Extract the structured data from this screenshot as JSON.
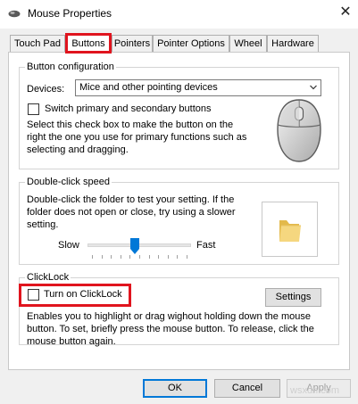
{
  "window": {
    "title": "Mouse Properties",
    "close_glyph": "✕"
  },
  "tabs": [
    {
      "label": "Touch Pad"
    },
    {
      "label": "Buttons"
    },
    {
      "label": "Pointers"
    },
    {
      "label": "Pointer Options"
    },
    {
      "label": "Wheel"
    },
    {
      "label": "Hardware"
    }
  ],
  "active_tab": "Buttons",
  "button_configuration": {
    "group_title": "Button configuration",
    "devices_label": "Devices:",
    "devices_value": "Mice and other pointing devices",
    "switch_label": "Switch primary and secondary buttons",
    "switch_checked": false,
    "description": "Select this check box to make the button on the right the one you use for primary functions such as selecting and dragging."
  },
  "double_click": {
    "group_title": "Double-click speed",
    "description": "Double-click the folder to test your setting. If the folder does not open or close, try using a slower setting.",
    "slow_label": "Slow",
    "fast_label": "Fast",
    "speed_fraction": 0.45
  },
  "clicklock": {
    "group_title": "ClickLock",
    "checkbox_label": "Turn on ClickLock",
    "checked": false,
    "settings_button": "Settings",
    "description": "Enables you to highlight or drag wighout holding down the mouse button. To set, briefly press the mouse button. To release, click the mouse button again."
  },
  "footer": {
    "ok": "OK",
    "cancel": "Cancel",
    "apply": "Apply"
  },
  "watermark": "wsxdn.com",
  "colors": {
    "highlight": "#e0141e",
    "accent": "#0078d7",
    "slider_thumb": "#0078d7",
    "folder": "#f3d57a"
  },
  "icons": {
    "title": "mouse-icon",
    "close": "close-icon",
    "dropdown": "chevron-down-icon",
    "mouse_image": "mouse-image",
    "folder": "folder-icon"
  }
}
